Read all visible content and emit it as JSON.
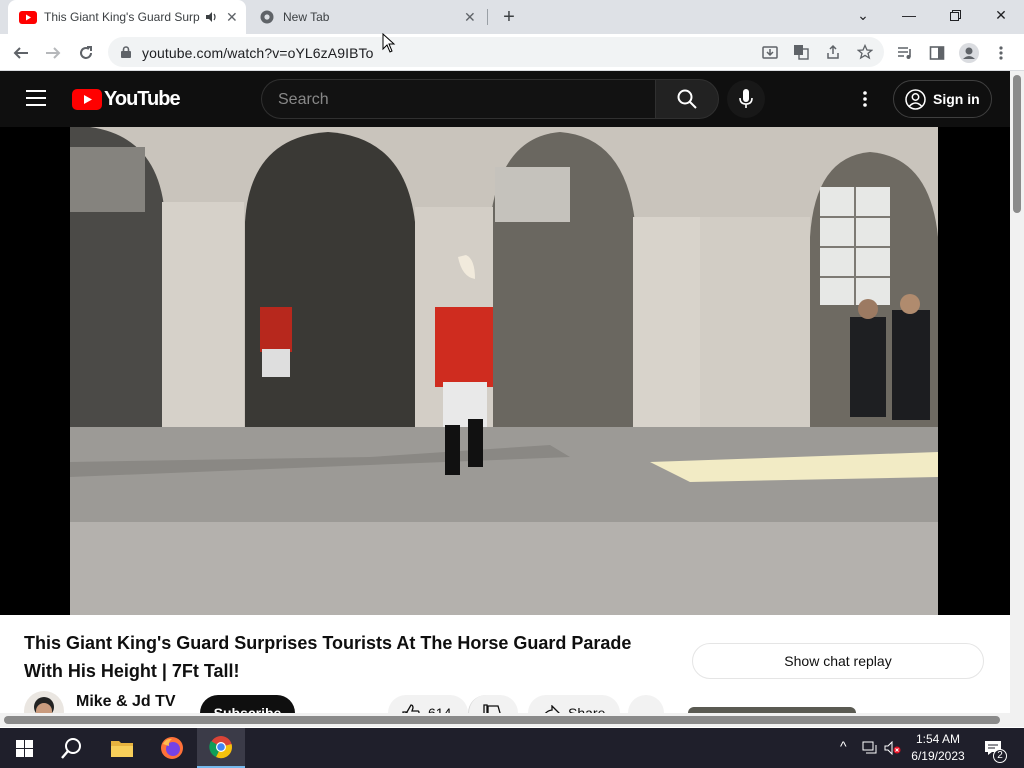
{
  "browser": {
    "tabs": [
      {
        "title": "This Giant King's Guard Surp",
        "active": true,
        "icon": "youtube-favicon",
        "audio": true
      },
      {
        "title": "New Tab",
        "active": false,
        "icon": "chrome-favicon"
      }
    ],
    "url": "youtube.com/watch?v=oYL6zA9IBTo",
    "icons": [
      "back-icon",
      "forward-icon",
      "reload-icon",
      "lock-icon",
      "install-icon",
      "translate-icon",
      "share-icon",
      "star-icon",
      "media-icon",
      "sidepanel-icon",
      "profile-icon",
      "menu-icon"
    ]
  },
  "youtube": {
    "logo_text": "YouTube",
    "search_placeholder": "Search",
    "sign_in": "Sign in",
    "video_title": "This Giant King's Guard Surprises Tourists At The Horse Guard Parade With His Height | 7Ft Tall!",
    "channel": "Mike & Jd TV",
    "subscribe": "Subscribe",
    "likes": "614",
    "share": "Share",
    "chat_replay": "Show chat replay"
  },
  "taskbar": {
    "time": "1:54 AM",
    "date": "6/19/2023",
    "notifications": "2"
  },
  "colors": {
    "yt_red": "#ff0000",
    "yt_dark": "#0f0f0f",
    "taskbar": "#1f1f2b"
  }
}
